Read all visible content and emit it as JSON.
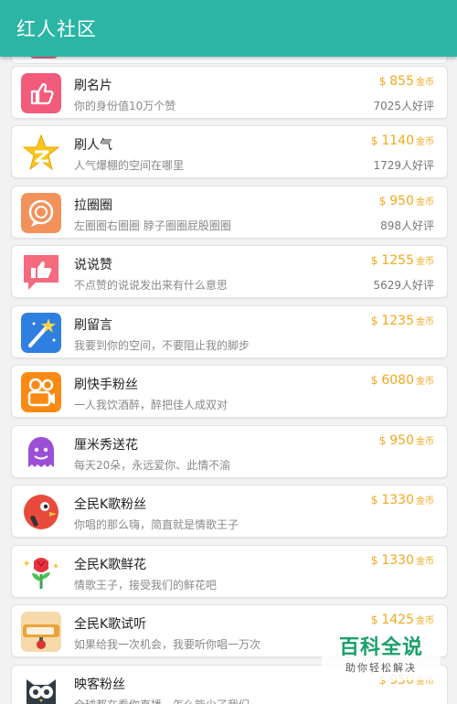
{
  "appbar": {
    "title": "红人社区"
  },
  "colors": {
    "accent": "#2ab5a5",
    "price": "#f0a81e"
  },
  "items": [
    {
      "icon": "thumbs-up-icon",
      "name": "刷名片",
      "desc": "你的身份值10万个赞",
      "currency": "$",
      "price": "855",
      "unit": "金币",
      "rating": "7025人好评"
    },
    {
      "icon": "qzone-star-icon",
      "name": "刷人气",
      "desc": "人气爆棚的空间在哪里",
      "currency": "$",
      "price": "1140",
      "unit": "金币",
      "rating": "1729人好评"
    },
    {
      "icon": "circle-badge-icon",
      "name": "拉圈圈",
      "desc": "左圈圈右圈圈 脖子圈圈屁股圈圈",
      "currency": "$",
      "price": "950",
      "unit": "金币",
      "rating": "898人好评"
    },
    {
      "icon": "like-bubble-icon",
      "name": "说说赞",
      "desc": "不点赞的说说发出来有什么意思",
      "currency": "$",
      "price": "1255",
      "unit": "金币",
      "rating": "5629人好评"
    },
    {
      "icon": "magic-wand-icon",
      "name": "刷留言",
      "desc": "我要到你的空间，不要阻止我的脚步",
      "currency": "$",
      "price": "1235",
      "unit": "金币",
      "rating": ""
    },
    {
      "icon": "video-camera-icon",
      "name": "刷快手粉丝",
      "desc": "一人我饮酒醉，醉把佳人成双对",
      "currency": "$",
      "price": "6080",
      "unit": "金币",
      "rating": ""
    },
    {
      "icon": "ghost-mascot-icon",
      "name": "厘米秀送花",
      "desc": "每天20朵，永远爱你、此情不渝",
      "currency": "$",
      "price": "950",
      "unit": "金币",
      "rating": ""
    },
    {
      "icon": "bird-mic-icon",
      "name": "全民K歌粉丝",
      "desc": "你唱的那么嗨，简直就是情歌王子",
      "currency": "$",
      "price": "1330",
      "unit": "金币",
      "rating": ""
    },
    {
      "icon": "rose-icon",
      "name": "全民K歌鲜花",
      "desc": "情歌王子，接受我们的鲜花吧",
      "currency": "$",
      "price": "1330",
      "unit": "金币",
      "rating": ""
    },
    {
      "icon": "karaoke-logo-icon",
      "name": "全民K歌试听",
      "desc": "如果给我一次机会，我要听你唱一万次",
      "currency": "$",
      "price": "1425",
      "unit": "金币",
      "rating": ""
    },
    {
      "icon": "owl-icon",
      "name": "映客粉丝",
      "desc": "全球都在看你直播，怎么能少了我们",
      "currency": "$",
      "price": "950",
      "unit": "金币",
      "rating": ""
    }
  ],
  "watermark": {
    "big": "百科全说",
    "small": "助你轻松解决"
  }
}
